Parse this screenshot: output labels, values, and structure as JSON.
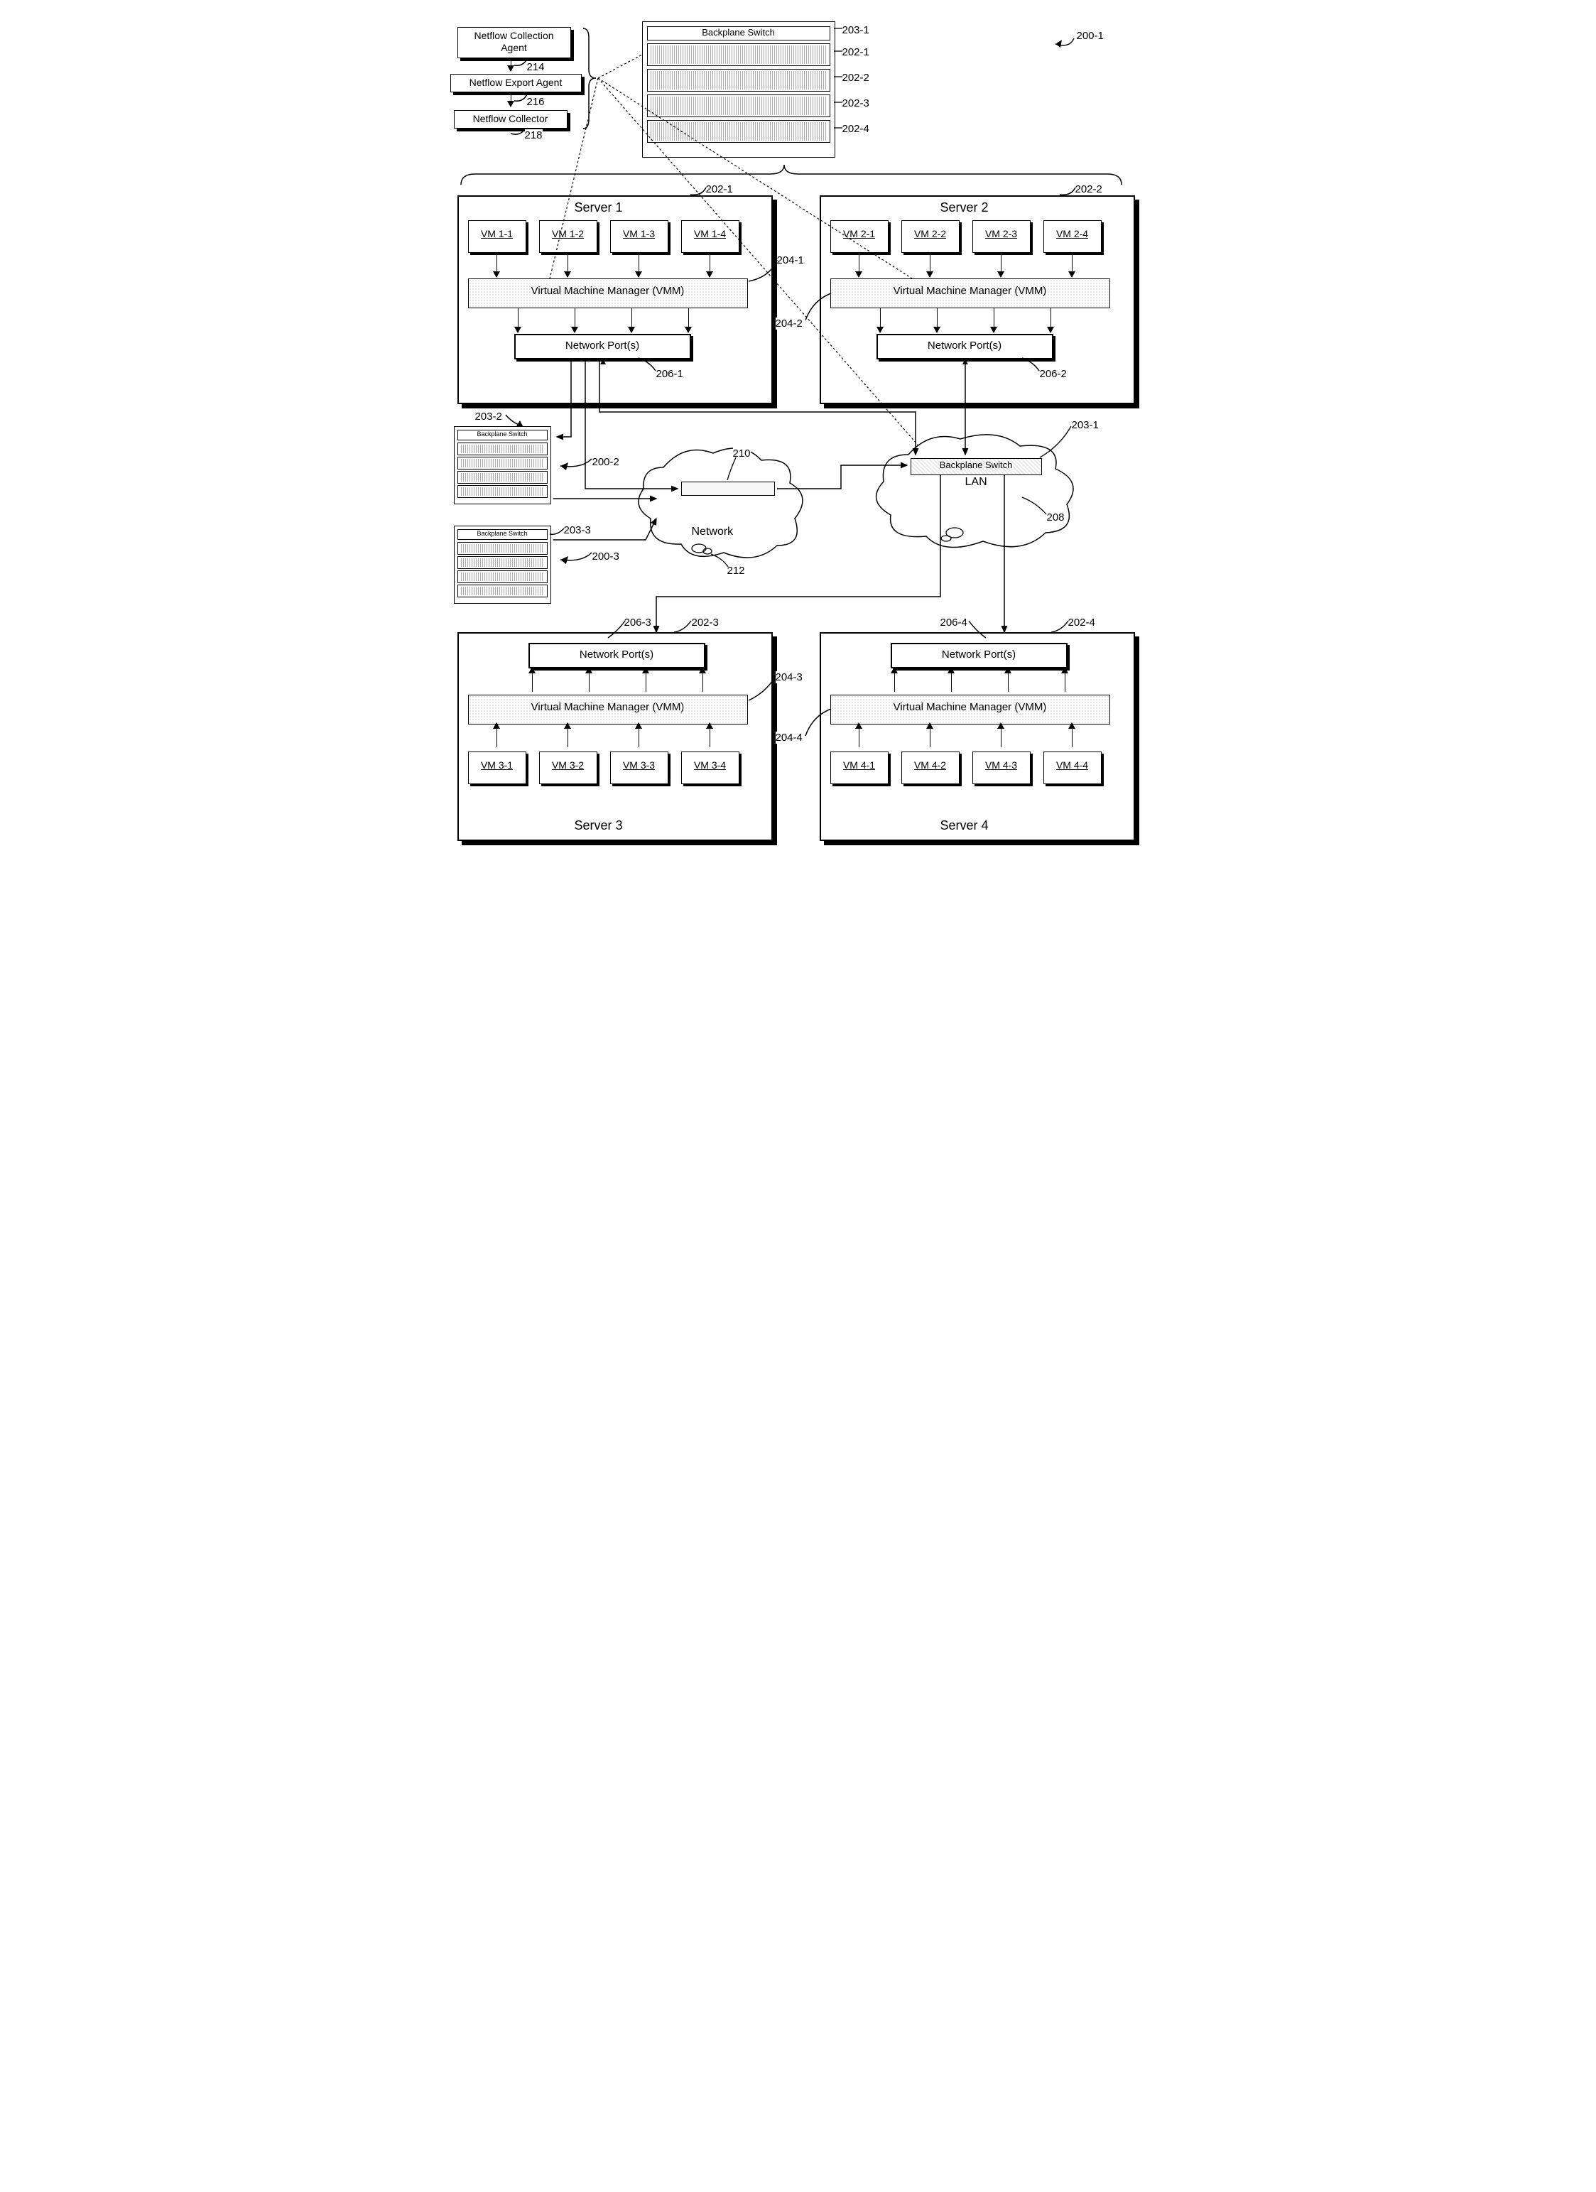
{
  "fig_ref_right": "200-1",
  "netflow": {
    "collection": "Netflow Collection Agent",
    "export": "Netflow Export Agent",
    "collector": "Netflow Collector",
    "ref_collection": "214",
    "ref_export": "216",
    "ref_collector": "218"
  },
  "rack_main": {
    "switch": "Backplane Switch",
    "ref_switch": "203-1",
    "refs": [
      "202-1",
      "202-2",
      "202-3",
      "202-4"
    ]
  },
  "servers": {
    "s1": {
      "title": "Server 1",
      "ref": "202-1",
      "vms": [
        "VM 1-1",
        "VM 1-2",
        "VM 1-3",
        "VM 1-4"
      ],
      "vmm": "Virtual Machine Manager (VMM)",
      "vmm_ref": "204-1",
      "np": "Network Port(s)",
      "np_ref": "206-1"
    },
    "s2": {
      "title": "Server 2",
      "ref": "202-2",
      "vms": [
        "VM 2-1",
        "VM 2-2",
        "VM 2-3",
        "VM 2-4"
      ],
      "vmm": "Virtual Machine Manager (VMM)",
      "vmm_ref": "204-2",
      "np": "Network Port(s)",
      "np_ref": "206-2"
    },
    "s3": {
      "title": "Server 3",
      "ref": "202-3",
      "vms": [
        "VM 3-1",
        "VM 3-2",
        "VM 3-3",
        "VM 3-4"
      ],
      "vmm": "Virtual Machine Manager (VMM)",
      "vmm_ref": "204-3",
      "np": "Network Port(s)",
      "np_ref": "206-3"
    },
    "s4": {
      "title": "Server 4",
      "ref": "202-4",
      "vms": [
        "VM 4-1",
        "VM 4-2",
        "VM 4-3",
        "VM 4-4"
      ],
      "vmm": "Virtual Machine Manager (VMM)",
      "vmm_ref": "204-4",
      "np": "Network Port(s)",
      "np_ref": "206-4"
    }
  },
  "mini_racks": {
    "r2": {
      "switch": "Backplane Switch",
      "ref": "203-2",
      "sys_ref": "200-2"
    },
    "r3": {
      "switch": "Backplane Switch",
      "ref": "203-3",
      "sys_ref": "200-3"
    }
  },
  "lan": {
    "switch": "Backplane Switch",
    "label": "LAN",
    "ref_switch": "203-1",
    "ref_lan": "208"
  },
  "network": {
    "label": "Network",
    "router_ref": "210",
    "cloud_ref": "212"
  }
}
